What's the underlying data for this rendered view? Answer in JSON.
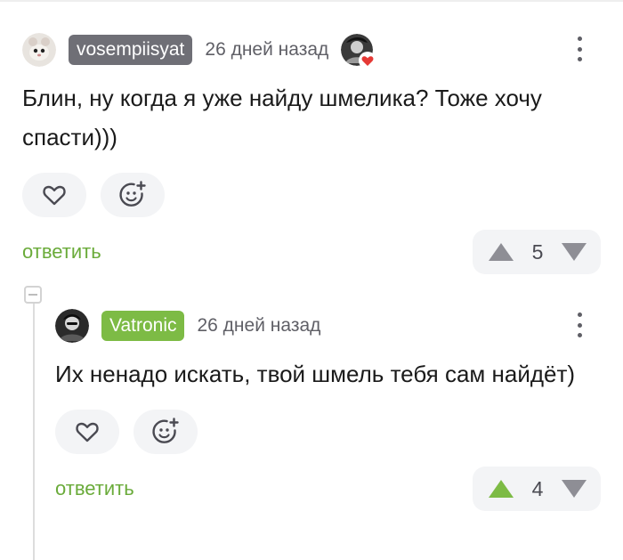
{
  "comment1": {
    "username": "vosempiisyat",
    "date": "26 дней назад",
    "text": "Блин, ну когда я уже найду шмелика? Тоже хочу спасти)))",
    "reply_label": "ответить",
    "score": "5",
    "vote_state": "none"
  },
  "comment2": {
    "username": "Vatronic",
    "date": "26 дней назад",
    "text": "Их ненадо искать, твой шмель тебя сам найдёт)",
    "reply_label": "ответить",
    "score": "4",
    "vote_state": "upvoted"
  },
  "colors": {
    "accent_green": "#6aab3a",
    "nick_gray": "#6f6f76",
    "nick_green": "#7dbb45",
    "arrow_gray": "#8e8e95",
    "arrow_active": "#7dbb45",
    "heart_red": "#e53935"
  },
  "icons": [
    "heart-outline-icon",
    "emoji-add-icon",
    "arrow-up-icon",
    "arrow-down-icon",
    "more-vertical-icon",
    "collapse-minus-icon"
  ]
}
